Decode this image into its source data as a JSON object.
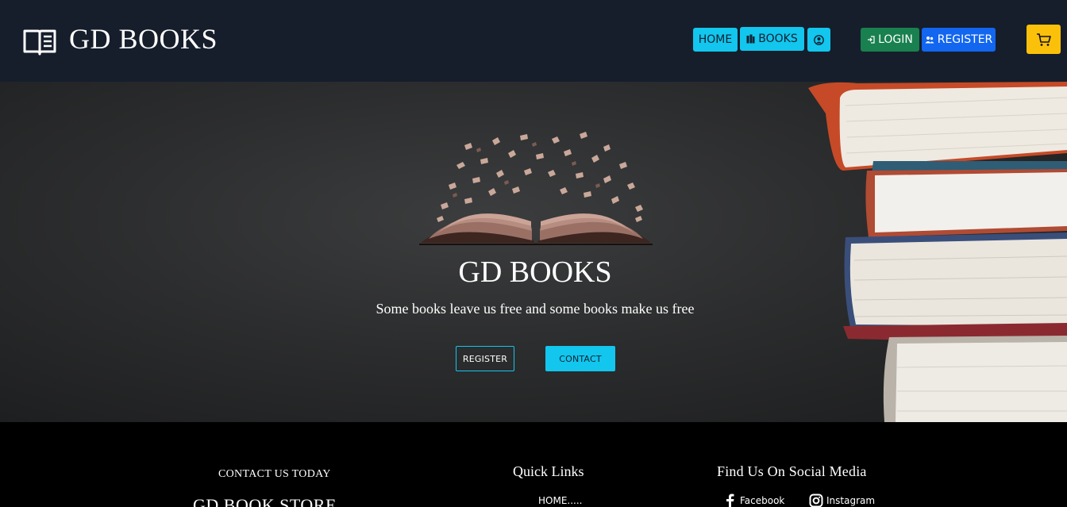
{
  "header": {
    "brand_title": "GD BOOKS",
    "brand_icon": "open-book-icon",
    "nav": {
      "home_label": "HOME",
      "books_label": "BOOKS",
      "books_icon": "books-icon",
      "profile_icon": "user-circle-icon",
      "login_label": "LOGIN",
      "login_icon": "login-icon",
      "register_label": "REGISTER",
      "register_icon": "users-icon",
      "cart_icon": "cart-icon"
    }
  },
  "hero": {
    "title": "GD BOOKS",
    "subtitle": "Some books leave us free and some books make us free",
    "register_button": "REGISTER",
    "contact_button": "CONTACT"
  },
  "footer": {
    "contact_heading": "CONTACT US TODAY",
    "store_name": "GD BOOK STORE",
    "quick_links_heading": "Quick Links",
    "quick_links": [
      "HOME....."
    ],
    "social_heading": "Find Us On Social Media",
    "social": [
      {
        "label": "Facebook",
        "icon": "facebook-icon"
      },
      {
        "label": "Instagram",
        "icon": "instagram-icon"
      }
    ]
  },
  "colors": {
    "header_bg": "#161e2c",
    "accent_cyan": "#12c6ee",
    "login_green": "#19804f",
    "register_blue": "#1266ef",
    "cart_yellow": "#fbc10a"
  }
}
